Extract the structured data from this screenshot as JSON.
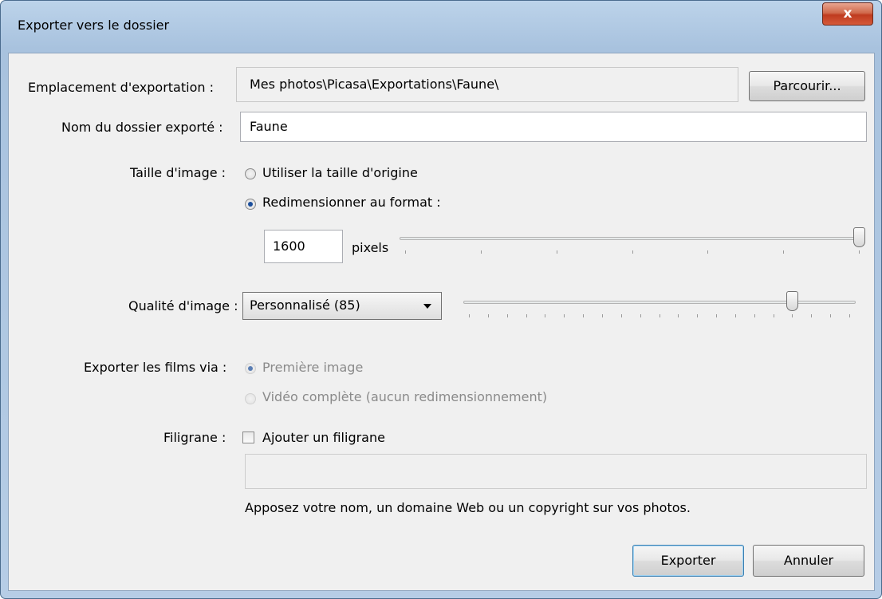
{
  "window": {
    "title": "Exporter vers le dossier",
    "close_glyph": "x"
  },
  "export_location": {
    "label": "Emplacement d'exportation :",
    "value": "Mes photos\\Picasa\\Exportations\\Faune\\",
    "browse_label": "Parcourir..."
  },
  "folder_name": {
    "label": "Nom du dossier exporté :",
    "value": "Faune"
  },
  "image_size": {
    "label": "Taille d'image :",
    "option_original": "Utiliser la taille d'origine",
    "option_resize": "Redimensionner au format :",
    "selected": "resize",
    "pixels_value": "1600",
    "pixels_unit": "pixels",
    "slider_level": 1.0,
    "tick_count": 7
  },
  "image_quality": {
    "label": "Qualité d'image :",
    "selected": "Personnalisé (85)",
    "slider_level": 0.85,
    "tick_count": 21
  },
  "movies": {
    "label": "Exporter les films via :",
    "option_first_frame": "Première image",
    "option_full_video": "Vidéo complète (aucun redimensionnement)",
    "selected": "first_frame",
    "enabled": false
  },
  "watermark": {
    "label": "Filigrane :",
    "checkbox_label": "Ajouter un filigrane",
    "checked": false,
    "text_value": "",
    "hint": "Apposez votre nom, un domaine Web ou un copyright sur vos photos."
  },
  "buttons": {
    "export": "Exporter",
    "cancel": "Annuler"
  }
}
